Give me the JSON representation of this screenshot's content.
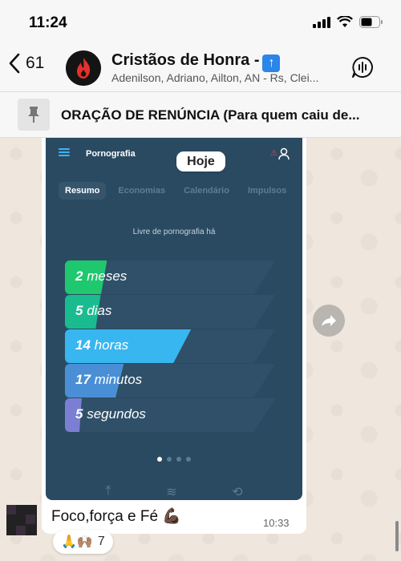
{
  "status": {
    "time": "11:24"
  },
  "header": {
    "back_count": "61",
    "group_name": "Cristãos de Honra -",
    "members": "Adenilson, Adriano, Ailton, AN - Rs, Clei..."
  },
  "pinned": {
    "text": "ORAÇÃO DE RENÚNCIA (Para quem caiu de..."
  },
  "date_pill": "Hoje",
  "app": {
    "title": "Pornografia",
    "warning": "⚠",
    "tabs": [
      {
        "label": "Resumo",
        "active": true
      },
      {
        "label": "Economias",
        "active": false
      },
      {
        "label": "Calendário",
        "active": false
      },
      {
        "label": "Impulsos",
        "active": false
      }
    ],
    "free_label": "Livre de pornografia há",
    "counters": [
      {
        "value": "2",
        "unit": "meses",
        "progress": 0.2,
        "color": "#1fc86e"
      },
      {
        "value": "5",
        "unit": "dias",
        "progress": 0.17,
        "color": "#1abc8f"
      },
      {
        "value": "14",
        "unit": "horas",
        "progress": 0.6,
        "color": "#38b6f0"
      },
      {
        "value": "17",
        "unit": "minutos",
        "progress": 0.28,
        "color": "#4a8fd6"
      },
      {
        "value": "5",
        "unit": "segundos",
        "progress": 0.08,
        "color": "#7a7fd4"
      }
    ],
    "dots": {
      "count": 4,
      "active_index": 0
    }
  },
  "message": {
    "caption": "Foco,força e Fé 💪🏿",
    "time": "10:33",
    "reactions": {
      "emojis": "🙏🙌🏽",
      "count": "7"
    }
  }
}
